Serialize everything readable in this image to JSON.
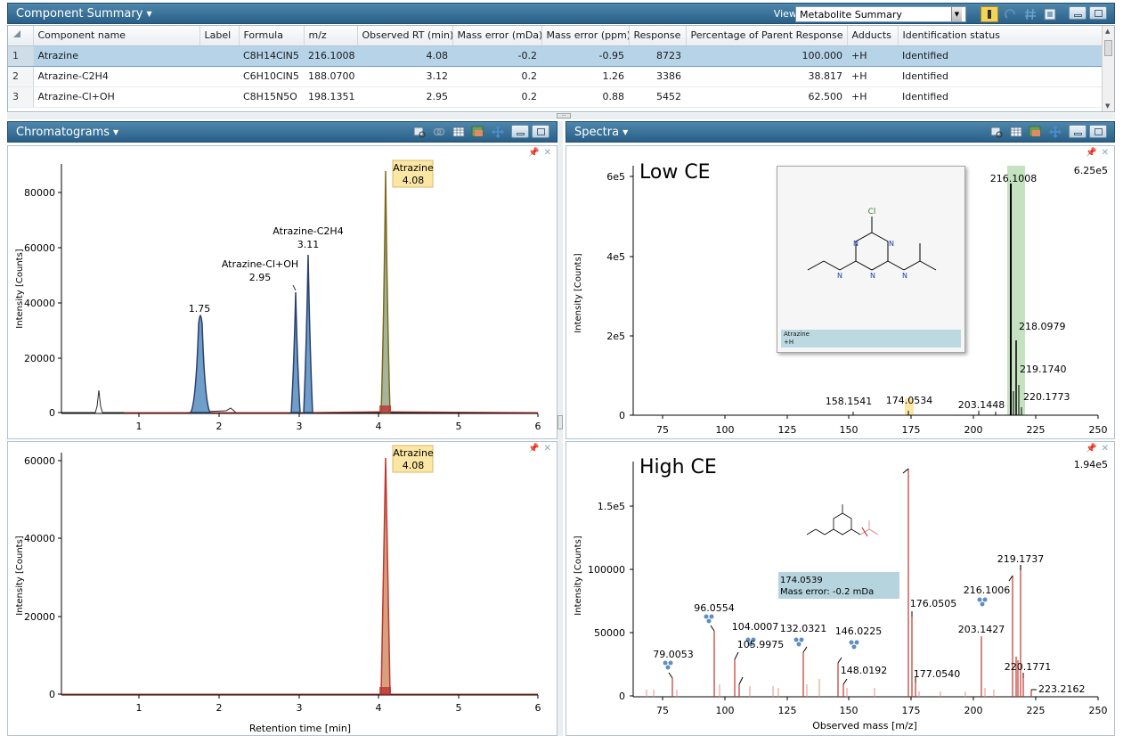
{
  "component_summary": {
    "title": "Component Summary",
    "view_label": "View:",
    "view_value": "Metabolite Summary",
    "columns": [
      "",
      "Component name",
      "Label",
      "Formula",
      "m/z",
      "Observed RT (min)",
      "Mass error (mDa)",
      "Mass error (ppm)",
      "Response",
      "Percentage of Parent Response (%)",
      "Adducts",
      "Identification status"
    ],
    "rows": [
      [
        "1",
        "Atrazine",
        "",
        "C8H14ClN5",
        "216.1008",
        "4.08",
        "-0.2",
        "-0.95",
        "8723",
        "100.000",
        "+H",
        "Identified"
      ],
      [
        "2",
        "Atrazine-C2H4",
        "",
        "C6H10ClN5",
        "188.0700",
        "3.12",
        "0.2",
        "1.26",
        "3386",
        "38.817",
        "+H",
        "Identified"
      ],
      [
        "3",
        "Atrazine-Cl+OH",
        "",
        "C8H15N5O",
        "198.1351",
        "2.95",
        "0.2",
        "0.88",
        "5452",
        "62.500",
        "+H",
        "Identified"
      ]
    ]
  },
  "chromatograms": {
    "title": "Chromatograms",
    "xlabel": "Retention time [min]",
    "ylabel": "Intensity [Counts]",
    "top": {
      "yticks": [
        "0",
        "20000",
        "40000",
        "60000",
        "80000"
      ],
      "xticks": [
        "1",
        "2",
        "3",
        "4",
        "5",
        "6"
      ],
      "labels": {
        "peak_175": "1.75",
        "cl_oh_name": "Atrazine-Cl+OH",
        "cl_oh_rt": "2.95",
        "c2h4_name": "Atrazine-C2H4",
        "c2h4_rt": "3.11",
        "atrazine_name": "Atrazine",
        "atrazine_rt": "4.08"
      }
    },
    "bottom": {
      "yticks": [
        "0",
        "20000",
        "40000",
        "60000"
      ],
      "xticks": [
        "1",
        "2",
        "3",
        "4",
        "5",
        "6"
      ],
      "labels": {
        "atrazine_name": "Atrazine",
        "atrazine_rt": "4.08"
      }
    }
  },
  "spectra": {
    "title": "Spectra",
    "xlabel": "Observed mass [m/z]",
    "ylabel": "Intensity [Counts]",
    "low": {
      "title": "Low CE",
      "max_label": "6.25e5",
      "yticks": [
        "0",
        "2e5",
        "4e5",
        "6e5"
      ],
      "xticks": [
        "75",
        "100",
        "125",
        "150",
        "175",
        "200",
        "225",
        "250"
      ],
      "peak_labels": [
        "216.1008",
        "218.0979",
        "219.1740",
        "220.1773",
        "158.1541",
        "174.0534",
        "203.1448"
      ]
    },
    "high": {
      "title": "High CE",
      "max_label": "1.94e5",
      "yticks": [
        "0",
        "50000",
        "100000",
        "1.5e5"
      ],
      "xticks": [
        "75",
        "100",
        "125",
        "150",
        "175",
        "200",
        "225",
        "250"
      ],
      "peak_labels": [
        "79.0053",
        "96.0554",
        "104.0007",
        "105.9975",
        "132.0321",
        "146.0225",
        "148.0192",
        "176.0505",
        "177.0540",
        "203.1427",
        "216.1006",
        "219.1737",
        "220.1771",
        "223.2162"
      ],
      "tooltip_mass": "174.0539",
      "tooltip_error": "Mass error: -0.2 mDa"
    },
    "structure_label_line1": "Atrazine",
    "structure_label_line2": "+H",
    "structure_atom_cl": "Cl",
    "structure_atom_n": "N"
  },
  "colors": {
    "header": "#2f6890",
    "selected_row": "#b6d3e8",
    "blue_peak": "#2b3f6e",
    "red_trace": "#c0362c",
    "highlight_green": "#b5dbb0",
    "label_yellow": "#fbe7a3"
  }
}
